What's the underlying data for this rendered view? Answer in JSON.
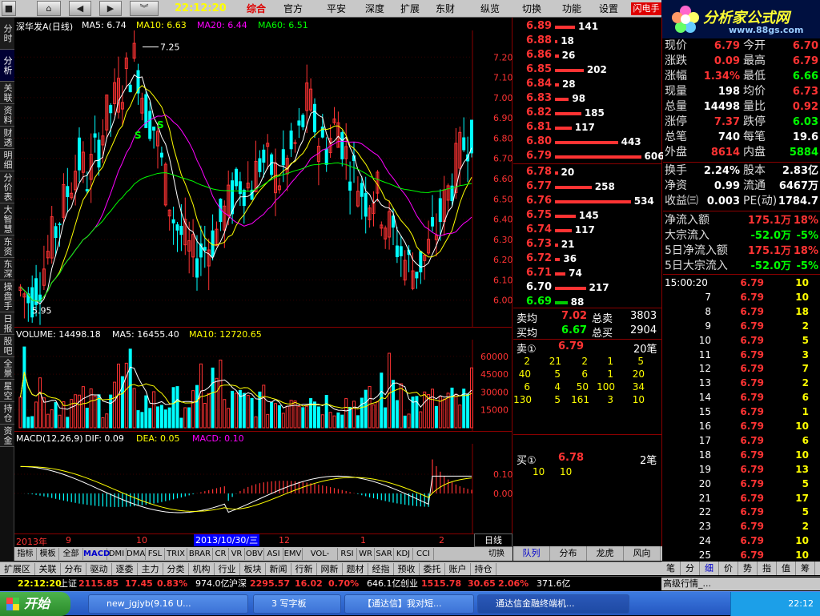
{
  "top": {
    "clock": "22:12:20",
    "menu": [
      "综合",
      "官方",
      "平安",
      "深度",
      "扩展",
      "东财",
      "纵览",
      "切换",
      "功能",
      "设置"
    ],
    "active_menu": "综合",
    "flash_label": "闪电手",
    "logo_text": "分析家公式网",
    "logo_url_text": "www.88gs.com"
  },
  "left_tabs": [
    "分时",
    "分析",
    "关联",
    "资料",
    "财透",
    "明细",
    "分价表",
    "大智慧",
    "东资",
    "东深",
    "操盘手",
    "日报",
    "股吧",
    "全景",
    "星空",
    "持仓",
    "资金"
  ],
  "chart": {
    "title": "深华发A(日线)",
    "ma5": "MA5: 6.74",
    "ma10": "MA10: 6.63",
    "ma20": "MA20: 6.44",
    "ma60": "MA60: 6.51",
    "high_label": "7.25",
    "low_label": "5.95",
    "price_ticks": [
      "7.20",
      "7.10",
      "7.00",
      "6.90",
      "6.80",
      "6.70",
      "6.60",
      "6.50",
      "6.40",
      "6.30",
      "6.20",
      "6.10",
      "6.00"
    ],
    "volume_header": "VOLUME: 14498.18",
    "vol_ma5": "MA5: 16455.40",
    "vol_ma10": "MA10: 12720.65",
    "volume_ticks": [
      "60000",
      "45000",
      "30000",
      "15000"
    ],
    "macd_header": "MACD(12,26,9)",
    "dif": "DIF: 0.09",
    "dea": "DEA: 0.05",
    "macd": "MACD: 0.10",
    "macd_ticks": [
      "0.10",
      "0.00"
    ],
    "signal_s": "S"
  },
  "axis": {
    "year": "2013年",
    "m9": "9",
    "m10": "10",
    "cursor_date": "2013/10/30/三",
    "m12": "12",
    "m1": "1",
    "m2": "2",
    "period": "日线",
    "controls": [
      "+",
      "-",
      "↓"
    ]
  },
  "indicators": [
    "指标",
    "模板",
    "全部",
    "MACD",
    "DMI",
    "DMA",
    "FSL",
    "TRIX",
    "BRAR",
    "CR",
    "VR",
    "OBV",
    "ASI",
    "EMV",
    "VOL-TDX",
    "RSI",
    "WR",
    "SAR",
    "KDJ",
    "CCI"
  ],
  "indicators_active": "MACD",
  "switch_label": "切换",
  "bottom_tabs": [
    "扩展区",
    "关联",
    "分布",
    "驱动",
    "逐委",
    "主力",
    "分类",
    "机构",
    "行业",
    "板块",
    "新闻",
    "行新",
    "网新",
    "题材",
    "经指",
    "预收",
    "委托",
    "账户",
    "持仓"
  ],
  "order_book": {
    "asks": [
      {
        "price": "6.89",
        "vol": "141"
      },
      {
        "price": "6.88",
        "vol": "18"
      },
      {
        "price": "6.86",
        "vol": "26"
      },
      {
        "price": "6.85",
        "vol": "202"
      },
      {
        "price": "6.84",
        "vol": "28"
      },
      {
        "price": "6.83",
        "vol": "98"
      },
      {
        "price": "6.82",
        "vol": "185"
      },
      {
        "price": "6.81",
        "vol": "117"
      },
      {
        "price": "6.80",
        "vol": "443"
      },
      {
        "price": "6.79",
        "vol": "606"
      }
    ],
    "bids": [
      {
        "price": "6.78",
        "vol": "20"
      },
      {
        "price": "6.77",
        "vol": "258"
      },
      {
        "price": "6.76",
        "vol": "534"
      },
      {
        "price": "6.75",
        "vol": "145"
      },
      {
        "price": "6.74",
        "vol": "117"
      },
      {
        "price": "6.73",
        "vol": "21"
      },
      {
        "price": "6.72",
        "vol": "36"
      },
      {
        "price": "6.71",
        "vol": "74"
      },
      {
        "price": "6.70",
        "vol": "217"
      },
      {
        "price": "6.69",
        "vol": "88"
      }
    ],
    "sell_avg_label": "卖均",
    "sell_avg": "7.02",
    "sell_total_label": "总卖",
    "sell_total": "3803",
    "buy_avg_label": "买均",
    "buy_avg": "6.67",
    "buy_total_label": "总买",
    "buy_total": "2904",
    "sell1_label": "卖①",
    "sell1_price": "6.79",
    "sell1_count": "20笔",
    "sell1_queue": [
      [
        "2",
        "21",
        "2",
        "1",
        "5"
      ],
      [
        "40",
        "5",
        "6",
        "1",
        "20"
      ],
      [
        "6",
        "4",
        "50",
        "100",
        "34"
      ],
      [
        "130",
        "5",
        "161",
        "3",
        "10"
      ]
    ],
    "buy1_label": "买①",
    "buy1_price": "6.78",
    "buy1_count": "2笔",
    "buy1_queue": [
      [
        "10",
        "10"
      ]
    ]
  },
  "mid_tabs": [
    "队列",
    "分布",
    "龙虎",
    "风向"
  ],
  "quote": {
    "rows": [
      {
        "l1": "现价",
        "v1": "6.79",
        "l2": "今开",
        "v2": "6.70"
      },
      {
        "l1": "涨跌",
        "v1": "0.09",
        "l2": "最高",
        "v2": "6.79"
      },
      {
        "l1": "涨幅",
        "v1": "1.34%",
        "l2": "最低",
        "v2": "6.66"
      },
      {
        "l1": "现量",
        "v1": "198",
        "l2": "均价",
        "v2": "6.73"
      },
      {
        "l1": "总量",
        "v1": "14498",
        "l2": "量比",
        "v2": "0.92"
      },
      {
        "l1": "涨停",
        "v1": "7.37",
        "l2": "跌停",
        "v2": "6.03"
      },
      {
        "l1": "总笔",
        "v1": "740",
        "l2": "每笔",
        "v2": "19.6"
      },
      {
        "l1": "外盘",
        "v1": "8614",
        "l2": "内盘",
        "v2": "5884"
      },
      {
        "l1": "换手",
        "v1": "2.24%",
        "l2": "股本",
        "v2": "2.83亿"
      },
      {
        "l1": "净资",
        "v1": "0.99",
        "l2": "流通",
        "v2": "6467万"
      },
      {
        "l1": "收益㈢",
        "v1": "0.003",
        "l2": "PE(动)",
        "v2": "1784.7"
      }
    ],
    "flows": [
      {
        "label": "净流入额",
        "value": "175.1万",
        "pct": "18%"
      },
      {
        "label": "大宗流入",
        "value": "-52.0万",
        "pct": "-5%"
      },
      {
        "label": "5日净流入额",
        "value": "175.1万",
        "pct": "18%"
      },
      {
        "label": "5日大宗流入",
        "value": "-52.0万",
        "pct": "-5%"
      }
    ]
  },
  "ticks": [
    {
      "t": "15:00:20",
      "p": "6.79",
      "v": "10"
    },
    {
      "t": "7",
      "p": "6.79",
      "v": "10"
    },
    {
      "t": "8",
      "p": "6.79",
      "v": "18"
    },
    {
      "t": "9",
      "p": "6.79",
      "v": "2"
    },
    {
      "t": "10",
      "p": "6.79",
      "v": "5"
    },
    {
      "t": "11",
      "p": "6.79",
      "v": "3"
    },
    {
      "t": "12",
      "p": "6.79",
      "v": "7"
    },
    {
      "t": "13",
      "p": "6.79",
      "v": "2"
    },
    {
      "t": "14",
      "p": "6.79",
      "v": "6"
    },
    {
      "t": "15",
      "p": "6.79",
      "v": "1"
    },
    {
      "t": "16",
      "p": "6.79",
      "v": "10"
    },
    {
      "t": "17",
      "p": "6.79",
      "v": "6"
    },
    {
      "t": "18",
      "p": "6.79",
      "v": "10"
    },
    {
      "t": "19",
      "p": "6.79",
      "v": "13"
    },
    {
      "t": "20",
      "p": "6.79",
      "v": "5"
    },
    {
      "t": "21",
      "p": "6.79",
      "v": "17"
    },
    {
      "t": "22",
      "p": "6.79",
      "v": "5"
    },
    {
      "t": "23",
      "p": "6.79",
      "v": "2"
    },
    {
      "t": "24",
      "p": "6.79",
      "v": "10"
    },
    {
      "t": "25",
      "p": "6.79",
      "v": "10"
    }
  ],
  "right_tabs": [
    "笔",
    "分",
    "细",
    "价",
    "势",
    "指",
    "值",
    "筹"
  ],
  "status": {
    "time": "22:12:20",
    "sh_label": "上证",
    "sh": "2115.85",
    "sh_chg": "17.45",
    "sh_pct": "0.83%",
    "sh_amt": "974.0亿",
    "sz_label": "沪深",
    "sz": "2295.57",
    "sz_chg": "16.02",
    "sz_pct": "0.70%",
    "sz_amt": "646.1亿",
    "cy_label": "创业",
    "cy": "1515.78",
    "cy_chg": "30.65",
    "cy_pct": "2.06%",
    "cy_amt": "371.6亿",
    "advanced": "高级行情_..."
  },
  "taskbar": {
    "start": "开始",
    "tasks": [
      "new_jgjyb(9.16 U...",
      "3 写字板",
      "【通达信】我对短...",
      "通达信金融终端机..."
    ],
    "tray_time": "22:12"
  }
}
